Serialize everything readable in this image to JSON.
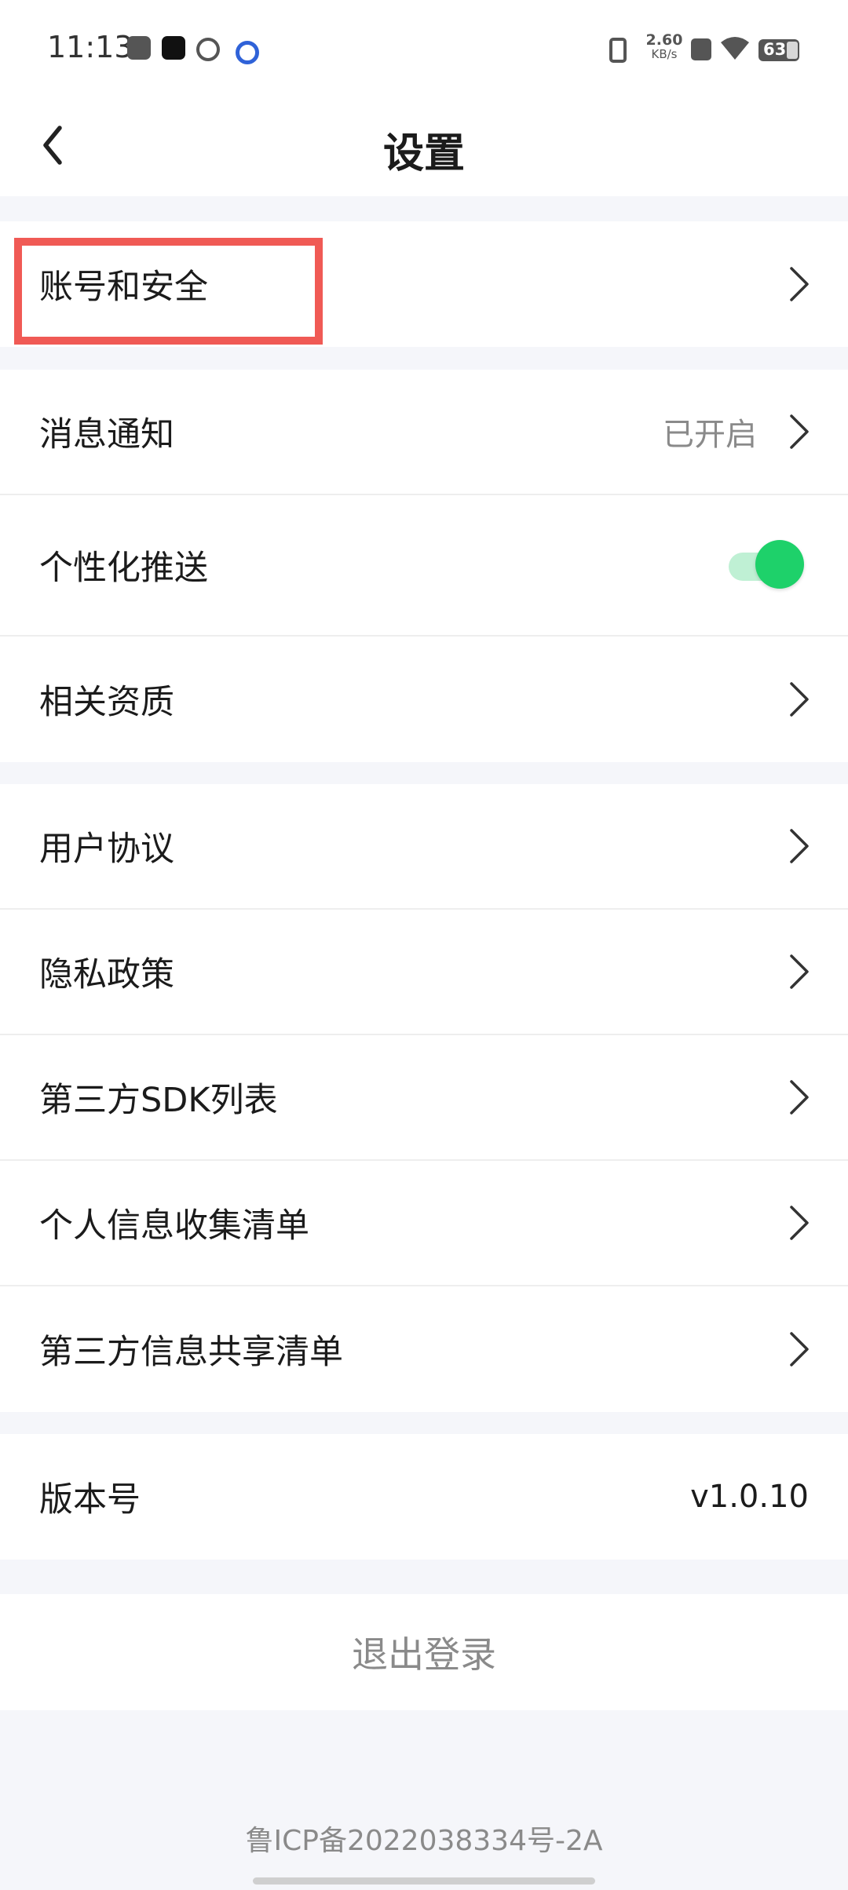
{
  "status_bar": {
    "time": "11:13",
    "net_speed_value": "2.60",
    "net_speed_unit": "KB/s",
    "battery": "63",
    "icons": [
      "mail-icon",
      "tiktok-icon",
      "leaf-app-icon",
      "circle-app-icon",
      "vibrate-icon",
      "sim-blocked-icon",
      "wifi-icon",
      "battery-icon"
    ]
  },
  "header": {
    "title": "设置",
    "back_icon": "chevron-left-icon"
  },
  "groups": [
    {
      "items": [
        {
          "label": "账号和安全",
          "type": "link"
        }
      ]
    },
    {
      "items": [
        {
          "label": "消息通知",
          "type": "link",
          "value": "已开启"
        },
        {
          "label": "个性化推送",
          "type": "toggle",
          "on": true
        },
        {
          "label": "相关资质",
          "type": "link"
        }
      ]
    },
    {
      "items": [
        {
          "label": "用户协议",
          "type": "link"
        },
        {
          "label": "隐私政策",
          "type": "link"
        },
        {
          "label": "第三方SDK列表",
          "type": "link"
        },
        {
          "label": "个人信息收集清单",
          "type": "link"
        },
        {
          "label": "第三方信息共享清单",
          "type": "link"
        }
      ]
    },
    {
      "items": [
        {
          "label": "版本号",
          "type": "info",
          "value": "v1.0.10"
        }
      ]
    }
  ],
  "logout_label": "退出登录",
  "footer": {
    "icp": "鲁ICP备2022038334号-2A"
  },
  "colors": {
    "toggle_on": "#1ed16a",
    "highlight_box": "#f05a55",
    "page_background": "#f5f6fa",
    "muted_text": "#8a8a8a"
  }
}
